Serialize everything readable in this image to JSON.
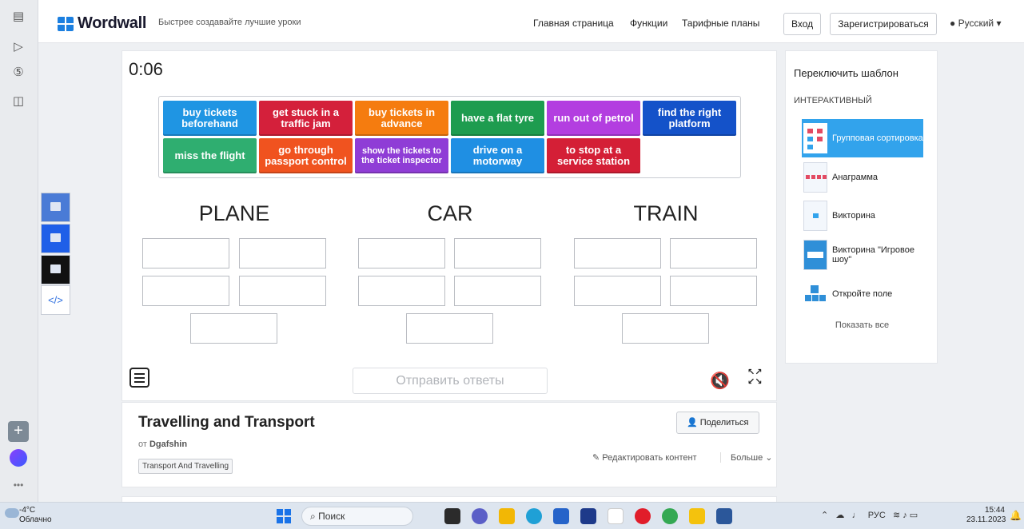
{
  "header": {
    "logo": "Wordwall",
    "tagline": "Быстрее создавайте лучшие уроки",
    "nav": [
      "Главная страница",
      "Функции",
      "Тарифные планы"
    ],
    "login": "Вход",
    "register": "Зарегистрироваться",
    "language": "Русский"
  },
  "game": {
    "timer": "0:06",
    "tiles": [
      {
        "text": "buy tickets beforehand",
        "color": "#1f95e3"
      },
      {
        "text": "get stuck in a traffic jam",
        "color": "#d4203b"
      },
      {
        "text": "buy tickets in advance",
        "color": "#f57c0f"
      },
      {
        "text": "have a flat tyre",
        "color": "#1e9c4f"
      },
      {
        "text": "run out of petrol",
        "color": "#b33ee0"
      },
      {
        "text": "find the right platform",
        "color": "#1452c9"
      },
      {
        "text": "miss the flight",
        "color": "#2fae70"
      },
      {
        "text": "go through passport control",
        "color": "#f0531f"
      },
      {
        "text": "show the tickets to the ticket inspector",
        "color": "#8f3dd6"
      },
      {
        "text": "drive on a motorway",
        "color": "#1f8fe3"
      },
      {
        "text": "to stop at a service station",
        "color": "#d41f36"
      }
    ],
    "categories": [
      "PLANE",
      "CAR",
      "TRAIN"
    ],
    "submit_label": "Отправить ответы"
  },
  "activity": {
    "title": "Travelling and Transport",
    "by_label": "от",
    "author": "Dgafshin",
    "tag": "Transport And Travelling",
    "share_label": "Поделиться",
    "edit_label": "Редактировать контент",
    "more_label": "Больше"
  },
  "switcher": {
    "title": "Переключить шаблон",
    "category": "ИНТЕРАКТИВНЫЙ",
    "templates": [
      "Групповая сортировка",
      "Анаграмма",
      "Викторина",
      "Викторина \"Игровое шоу\"",
      "Откройте поле"
    ],
    "show_all": "Показать все"
  },
  "taskbar": {
    "temperature": "-4°C",
    "weather": "Облачно",
    "search": "Поиск",
    "lang": "РУС",
    "time": "15:44",
    "date": "23.11.2023"
  }
}
